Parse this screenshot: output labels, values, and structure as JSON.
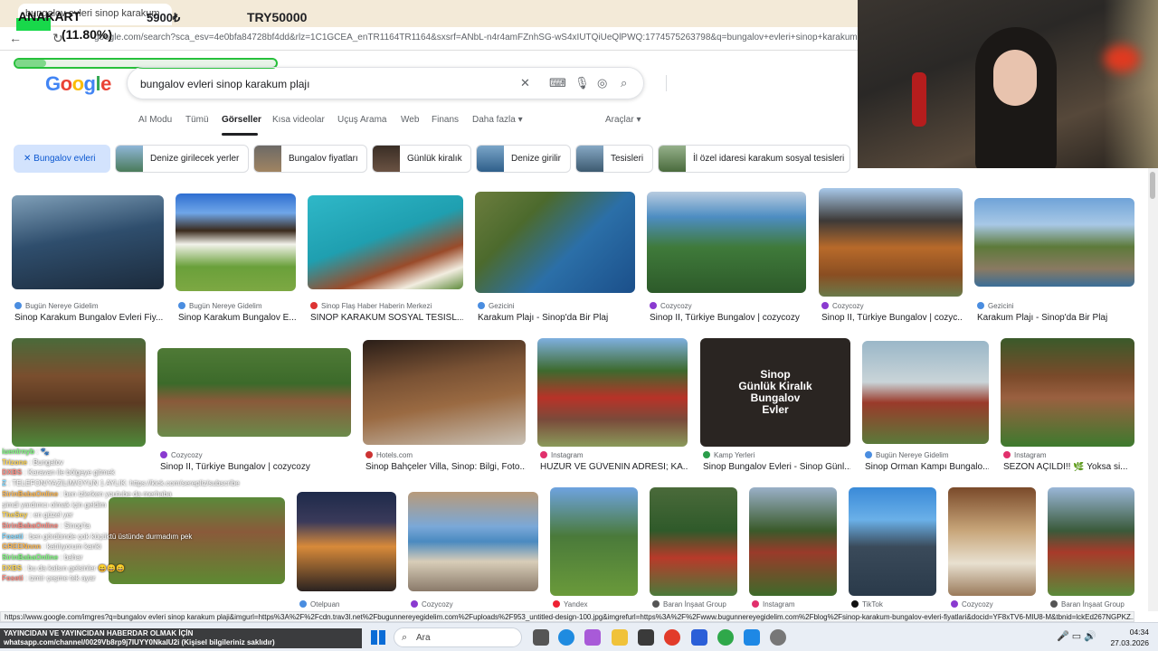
{
  "browser": {
    "tab_title": "bungalov evleri sinop karakum",
    "url": "google.com/search?sca_esv=4e0bfa84728bf4dd&rlz=1C1GCEA_enTR1164TR1164&sxsrf=ANbL-n4r4amFZnhSG-wS4xIUTQiUeQlPWQ:1774575263798&q=bungalov+evleri+sinop+karakum+plaji&uds=ALYpb8nEX...",
    "status_url": "https://www.google.com/imgres?q=bungalov evleri sinop karakum plaji&imgurl=https%3A%2F%2Fcdn.trav3l.net%2Fbugunnereyegidelim.com%2Fuploads%2F953_untitled-design-100.jpg&imgrefurl=https%3A%2F%2Fwww.bugunnereyegidelim.com%2Fblog%2Fsinop-karakum-bungalov-evleri-fiyatlari&docid=YF8xTV6-MIU8-M&tbnid=lckEd267NGPKZ..."
  },
  "overlay": {
    "ticker": "ANAKART",
    "price": "5900₺",
    "target": "TRY50000",
    "percent": "(11.80%)",
    "progress": 0.118
  },
  "google": {
    "logo": [
      "G",
      "o",
      "o",
      "g",
      "l",
      "e"
    ],
    "query": "bungalov evleri sinop karakum plajı",
    "tabs": [
      "AI Modu",
      "Tümü",
      "Görseller",
      "Kısa videolar",
      "Uçuş Arama",
      "Web",
      "Finans",
      "Daha fazla ▾"
    ],
    "active_tab": "Görseller",
    "tools": "Araçlar ▾"
  },
  "chips": [
    {
      "label": "✕  Bungalov evleri",
      "selected": true
    },
    {
      "label": "Denize girilecek yerler"
    },
    {
      "label": "Bungalov fiyatları"
    },
    {
      "label": "Günlük kiralık"
    },
    {
      "label": "Denize girilir"
    },
    {
      "label": "Tesisleri"
    },
    {
      "label": "İl özel idaresi karakum sosyal tesisleri"
    }
  ],
  "results": [
    {
      "source": "Bugün Nereye Gidelim",
      "title": "Sinop Karakum Bungalov Evleri Fiy..."
    },
    {
      "source": "Bugün Nereye Gidelim",
      "title": "Sinop Karakum Bungalov E..."
    },
    {
      "source": "Sinop Flaş Haber Haberin Merkezi",
      "title": "SİNOP KARAKUM SOSYAL TESİSL..."
    },
    {
      "source": "Gezicini",
      "title": "Karakum Plajı - Sinop'da Bir Plaj"
    },
    {
      "source": "Cozycozy",
      "title": "Sinop II, Türkiye Bungalov | cozycozy"
    },
    {
      "source": "Cozycozy",
      "title": "Sinop II, Türkiye Bungalov | cozyc..."
    },
    {
      "source": "Gezicini",
      "title": "Karakum Plajı - Sinop'da Bir Plaj"
    },
    {
      "source": "",
      "title": ""
    },
    {
      "source": "Cozycozy",
      "title": "Sinop II, Türkiye Bungalov | cozycozy"
    },
    {
      "source": "Hotels.com",
      "title": "Sinop Bahçeler Villa, Sinop: Bilgi, Foto..."
    },
    {
      "source": "Instagram",
      "title": "HUZUR VE GÜVENİN ADRESİ; KA..."
    },
    {
      "source": "Kamp Yerleri",
      "title": "Sinop Bungalov Evleri - Sinop Günl..."
    },
    {
      "source": "Bugün Nereye Gidelim",
      "title": "Sinop Orman Kampı Bungalo..."
    },
    {
      "source": "Instagram",
      "title": "SEZON AÇILDI!! 🌿 Yoksa si..."
    },
    {
      "source": "Otelpuan",
      "title": ""
    },
    {
      "source": "Cozycozy",
      "title": ""
    },
    {
      "source": "Yandex",
      "title": ""
    },
    {
      "source": "Baran İnşaat Group",
      "title": ""
    },
    {
      "source": "Instagram",
      "title": ""
    },
    {
      "source": "TikTok",
      "title": ""
    },
    {
      "source": "Cozycozy",
      "title": ""
    },
    {
      "source": "Baran İnşaat Group",
      "title": ""
    }
  ],
  "image_overlay_text": [
    "Sinop",
    "Günlük Kiralık",
    "Bungalov",
    "Evler"
  ],
  "chat": [
    {
      "name": "iuenlrnyb",
      "text": ": 🐾"
    },
    {
      "name": "Trizone",
      "text": ": Bungalov"
    },
    {
      "name": "DXBS",
      "text": ": Karavan ile bölgeye gitmek"
    },
    {
      "name": "Z",
      "text": ": TELEFON/YAZILIM/OYUN 1 AYLIK: https://kick.com/serepliz/subscribe"
    },
    {
      "name": "SirinBabaOnline",
      "text": ": ben izlerken youtube da merhaba"
    },
    {
      "name": "",
      "text": "şimdi yardımcı olmak için geldim"
    },
    {
      "name": "TheSey",
      "text": ": en güzel yer"
    },
    {
      "name": "SirinBabaOnline",
      "text": ": Sinop'ta"
    },
    {
      "name": "Foseti",
      "text": ": ben gördümde çok küçüktü üstünde durmadım pek"
    },
    {
      "name": "GREENnnn",
      "text": ": katılıyorum kanki"
    },
    {
      "name": "SirinBabaOnline",
      "text": ": bahar"
    },
    {
      "name": "DXBS",
      "text": ": bu da kalsın gelsinler 😄😄😄"
    },
    {
      "name": "Foseti",
      "text": ": izmir çeşme tek ayar"
    }
  ],
  "banner": "YAYINCIDAN VE YAYINCIDAN HABERDAR OLMAK İÇİN\nwhatsapp.com/channel/0029Vb8rp9j7IUYY0NkaIU2i (Kişisel bilgileriniz saklıdır)",
  "taskbar": {
    "search": "Ara",
    "time": "04:34",
    "date": "27.03.2026"
  },
  "icons": [
    "back-icon",
    "forward-icon",
    "reload-icon",
    "clear-icon",
    "keyboard-icon",
    "mic-icon",
    "lens-icon",
    "search-icon"
  ]
}
